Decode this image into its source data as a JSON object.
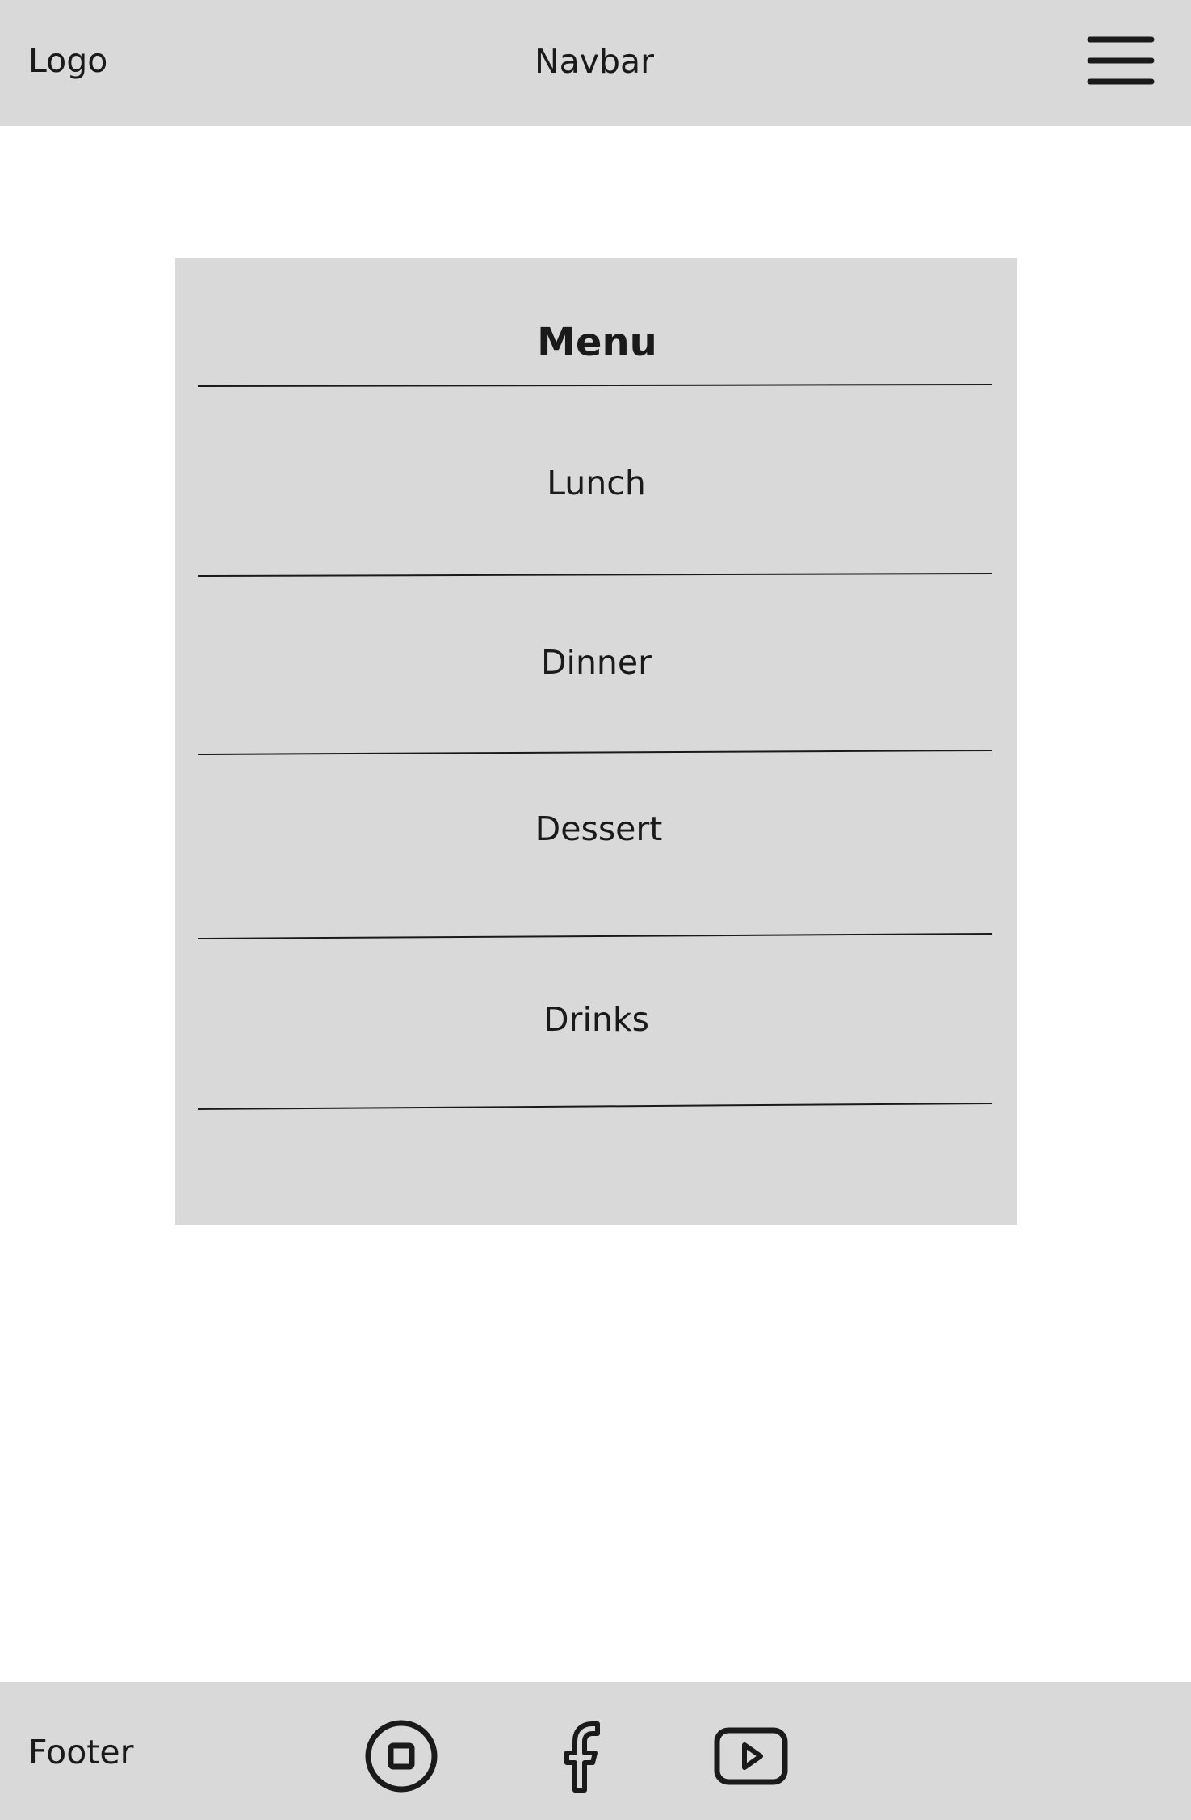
{
  "navbar": {
    "logo": "Logo",
    "title": "Navbar",
    "menu_icon": "hamburger-menu-icon"
  },
  "menu": {
    "title": "Menu",
    "items": [
      {
        "label": "Lunch"
      },
      {
        "label": "Dinner"
      },
      {
        "label": "Dessert"
      },
      {
        "label": "Drinks"
      }
    ]
  },
  "footer": {
    "label": "Footer",
    "social_icons": [
      "instagram-icon",
      "facebook-icon",
      "youtube-icon"
    ]
  },
  "colors": {
    "panel_gray": "#d9d9d9",
    "background": "#ffffff",
    "ink": "#1a1a1a"
  }
}
